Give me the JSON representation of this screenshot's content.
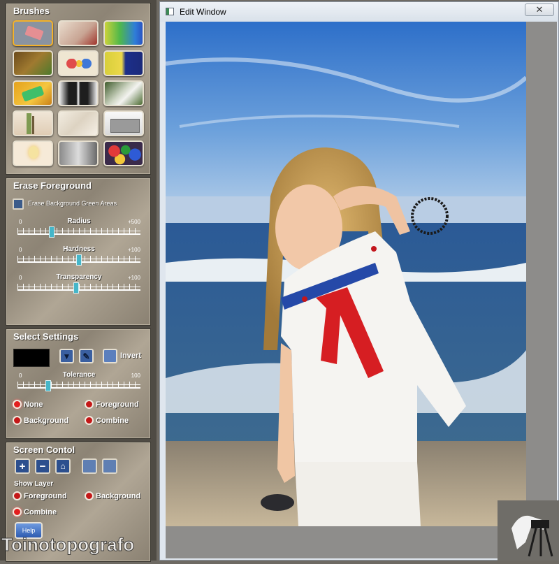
{
  "panel": {
    "brushes": {
      "title": "Brushes",
      "items": [
        {
          "icon": "eraser-brush-icon"
        },
        {
          "icon": "bride-photo-brush-icon"
        },
        {
          "icon": "gradient-brush-icon"
        },
        {
          "icon": "hair-brush-icon"
        },
        {
          "icon": "paint-palette-brush-icon"
        },
        {
          "icon": "yellow-blue-gradient-brush-icon"
        },
        {
          "icon": "leaf-brush-icon"
        },
        {
          "icon": "tuxedo-brush-icon"
        },
        {
          "icon": "wedding-dress-brush-icon"
        },
        {
          "icon": "palm-tree-brush-icon"
        },
        {
          "icon": "fabric-brush-icon"
        },
        {
          "icon": "machine-brush-icon"
        },
        {
          "icon": "light-bulb-brush-icon"
        },
        {
          "icon": "gray-gradient-brush-icon"
        },
        {
          "icon": "paint-cans-brush-icon"
        }
      ]
    },
    "erase": {
      "title": "Erase Foreground",
      "checkbox_label": "Erase Background Green Areas",
      "sliders": [
        {
          "label": "Radius",
          "min": "0",
          "max": "+500",
          "value": 140
        },
        {
          "label": "Hardness",
          "min": "0",
          "max": "+100",
          "value": 50
        },
        {
          "label": "Transparency",
          "min": "0",
          "max": "+100",
          "value": 48
        }
      ]
    },
    "select": {
      "title": "Select Settings",
      "invert_label": "Invert",
      "tolerance": {
        "label": "Tolerance",
        "min": "0",
        "max": "100",
        "value": 25
      },
      "radios": [
        {
          "label": "None",
          "on": true
        },
        {
          "label": "Foreground",
          "on": false
        },
        {
          "label": "Background",
          "on": false
        },
        {
          "label": "Combine",
          "on": false
        }
      ]
    },
    "screen": {
      "title": "Screen Contol",
      "show_layer_label": "Show Layer",
      "layers": [
        {
          "label": "Foreground"
        },
        {
          "label": "Background"
        },
        {
          "label": "Combine"
        }
      ],
      "help_label": "Help"
    }
  },
  "edit_window": {
    "title": "Edit Window",
    "close_symbol": "✕"
  },
  "watermark": "Toinotopografo"
}
